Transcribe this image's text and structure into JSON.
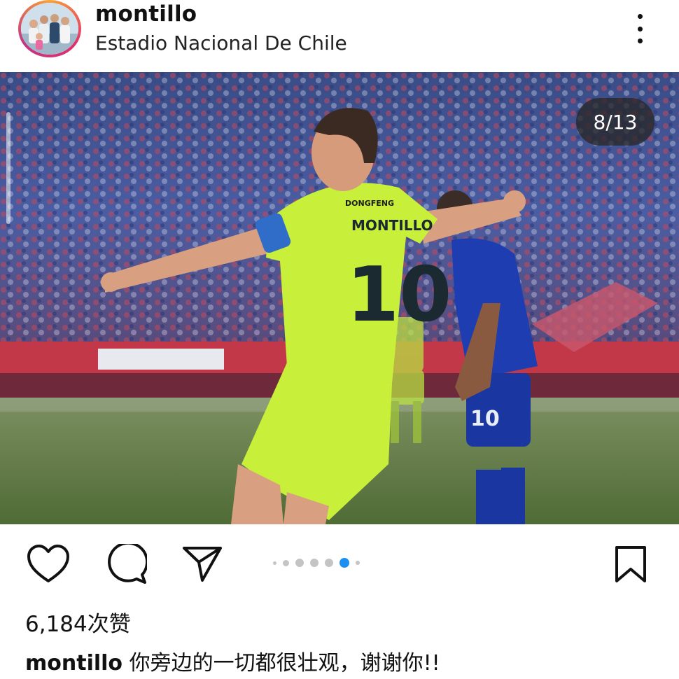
{
  "post": {
    "username": "montillo",
    "location": "Estadio Nacional De Chile",
    "carousel_counter": "8/13",
    "likes": "6,184次赞",
    "caption_user": "montillo",
    "caption_text": "你旁边的一切都很壮观，谢谢你!!"
  },
  "photo": {
    "jersey_sponsor": "DONGFENG",
    "jersey_name": "MONTILLO",
    "jersey_number": "10",
    "opponent_number": "10"
  },
  "carousel_dots": {
    "count": 7,
    "active_index": 5
  },
  "colors": {
    "accent_blue": "#1d8ff2",
    "dot_grey": "#c4c4c4",
    "jersey_yellow": "#c8ef3a"
  }
}
